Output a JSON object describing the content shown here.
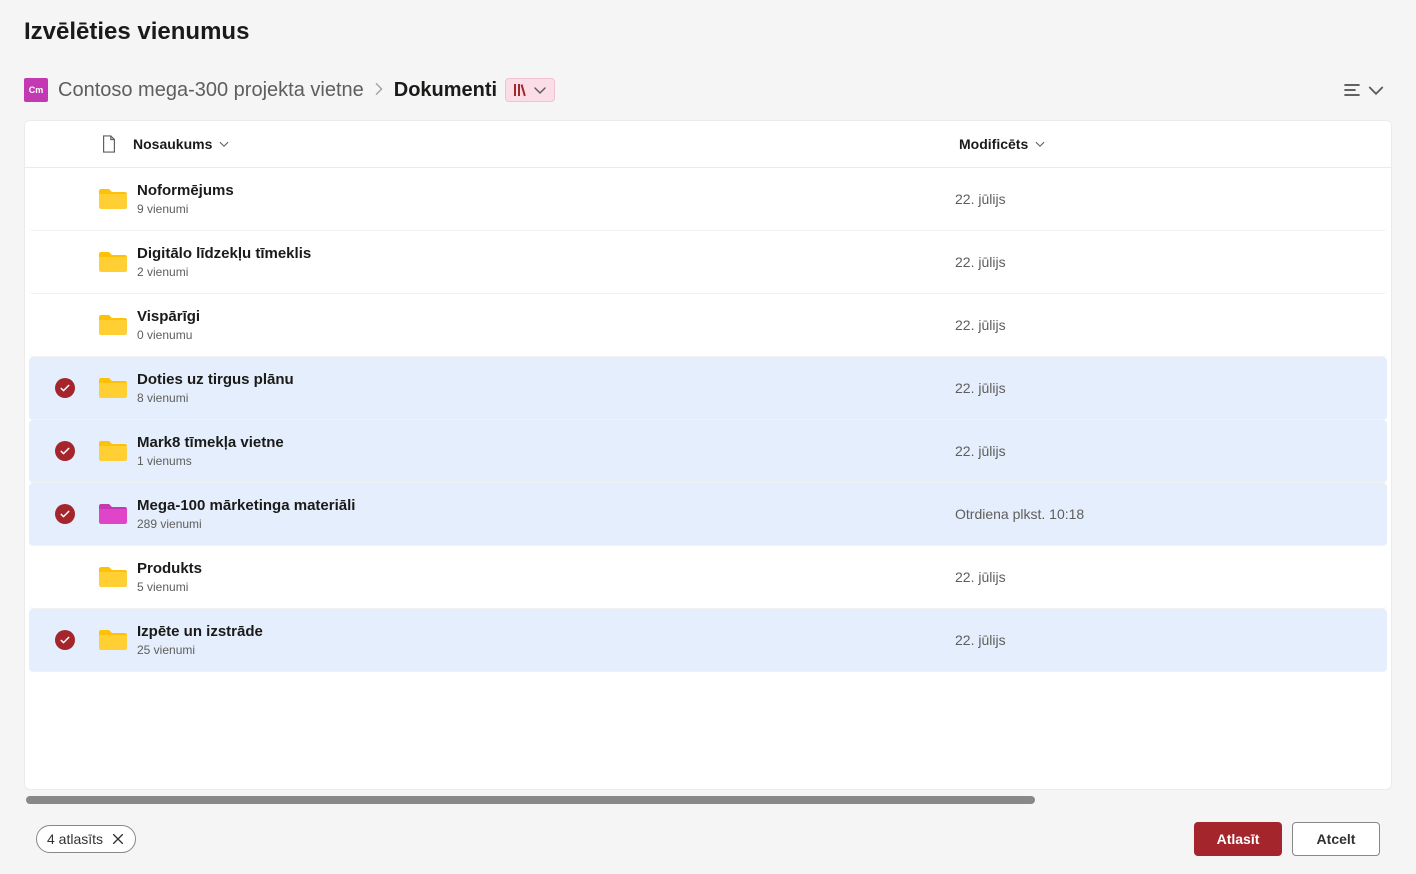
{
  "dialog": {
    "title": "Izvēlēties vienumus"
  },
  "site": {
    "icon_text": "Cm"
  },
  "breadcrumb": {
    "site": "Contoso mega-300 projekta vietne",
    "current": "Dokumenti"
  },
  "columns": {
    "name": "Nosaukums",
    "modified": "Modificēts"
  },
  "rows": [
    {
      "name": "Noformējums",
      "sub": "9 vienumi",
      "modified": "22. jūlijs",
      "selected": false,
      "color": "yellow"
    },
    {
      "name": "Digitālo līdzekļu tīmeklis",
      "sub": "2 vienumi",
      "modified": "22. jūlijs",
      "selected": false,
      "color": "yellow"
    },
    {
      "name": "Vispārīgi",
      "sub": "0 vienumu",
      "modified": "22. jūlijs",
      "selected": false,
      "color": "yellow"
    },
    {
      "name": "Doties uz tirgus plānu",
      "sub": "8 vienumi",
      "modified": "22. jūlijs",
      "selected": true,
      "color": "yellow"
    },
    {
      "name": "Mark8 tīmekļa vietne",
      "sub": "1 vienums",
      "modified": "22. jūlijs",
      "selected": true,
      "color": "yellow"
    },
    {
      "name": "Mega-100 mārketinga materiāli",
      "sub": "289 vienumi",
      "modified": "Otrdiena plkst. 10:18",
      "selected": true,
      "color": "magenta"
    },
    {
      "name": "Produkts",
      "sub": "5 vienumi",
      "modified": "22. jūlijs",
      "selected": false,
      "color": "yellow"
    },
    {
      "name": "Izpēte un izstrāde",
      "sub": "25 vienumi",
      "modified": "22. jūlijs",
      "selected": true,
      "color": "yellow"
    }
  ],
  "footer": {
    "selection_label": "4 atlasīts",
    "primary": "Atlasīt",
    "secondary": "Atcelt"
  }
}
